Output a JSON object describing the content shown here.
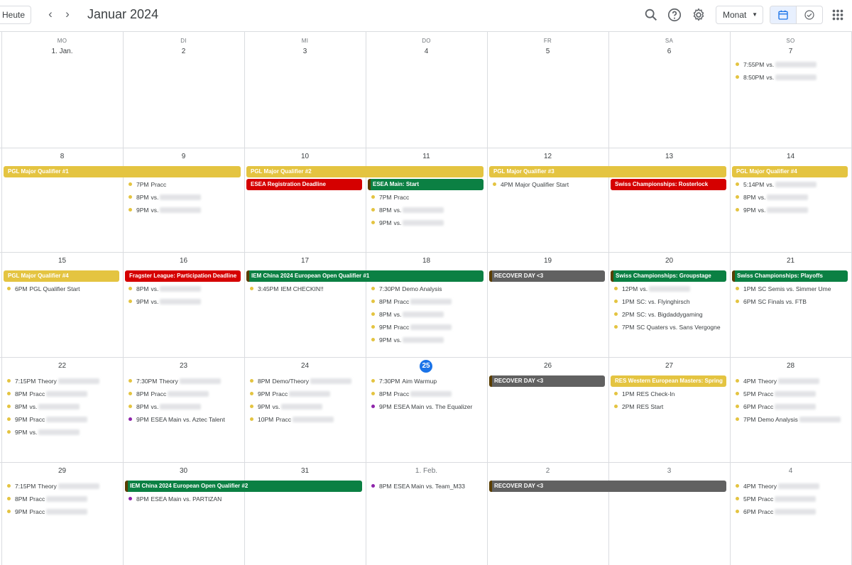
{
  "header": {
    "today_label": "Heute",
    "title": "Januar 2024",
    "view_label": "Monat",
    "icons": [
      "chevron-left-icon",
      "chevron-right-icon",
      "search-icon",
      "help-icon",
      "settings-icon",
      "calendar-icon",
      "tasks-icon",
      "apps-icon"
    ]
  },
  "weekdays": [
    "MO",
    "DI",
    "MI",
    "DO",
    "FR",
    "SA",
    "SO"
  ],
  "weeks": [
    [
      "1. Jan.",
      "2",
      "3",
      "4",
      "5",
      "6",
      "7"
    ],
    [
      "8",
      "9",
      "10",
      "11",
      "12",
      "13",
      "14"
    ],
    [
      "15",
      "16",
      "17",
      "18",
      "19",
      "20",
      "21"
    ],
    [
      "22",
      "23",
      "24",
      "25",
      "26",
      "27",
      "28"
    ],
    [
      "29",
      "30",
      "31",
      "1. Feb.",
      "2",
      "3",
      "4"
    ]
  ],
  "today": {
    "week": 3,
    "day": 3,
    "label": "25"
  },
  "colors": {
    "yellow": "#e4c441",
    "red": "#d50000",
    "green": "#0b8043",
    "gray": "#616161",
    "purple": "#8e24aa",
    "today": "#1a73e8"
  },
  "banners": [
    {
      "week": 1,
      "start": 0,
      "span": 2,
      "row": 0,
      "label": "PGL Major Qualifier #1",
      "color": "#e4c441"
    },
    {
      "week": 1,
      "start": 2,
      "span": 2,
      "row": 0,
      "label": "PGL Major Qualifier #2",
      "color": "#e4c441"
    },
    {
      "week": 1,
      "start": 4,
      "span": 2,
      "row": 0,
      "label": "PGL Major Qualifier #3",
      "color": "#e4c441"
    },
    {
      "week": 1,
      "start": 6,
      "span": 1,
      "row": 0,
      "label": "PGL Major Qualifier #4",
      "color": "#e4c441"
    },
    {
      "week": 1,
      "start": 2,
      "span": 1,
      "row": 1,
      "label": "ESEA Registration Deadline",
      "color": "#d50000"
    },
    {
      "week": 1,
      "start": 3,
      "span": 1,
      "row": 1,
      "label": "ESEA Main: Start",
      "color": "#0b8043"
    },
    {
      "week": 1,
      "start": 5,
      "span": 1,
      "row": 1,
      "label": "Swiss Championships: Rosterlock",
      "color": "#d50000"
    },
    {
      "week": 2,
      "start": 0,
      "span": 1,
      "row": 0,
      "label": "PGL Major Qualifier #4",
      "color": "#e4c441"
    },
    {
      "week": 2,
      "start": 1,
      "span": 1,
      "row": 0,
      "label": "Fragster League: Participation Deadline",
      "color": "#d50000"
    },
    {
      "week": 2,
      "start": 2,
      "span": 2,
      "row": 0,
      "label": "IEM China 2024 European Open Qualifier #1",
      "color": "#0b8043"
    },
    {
      "week": 2,
      "start": 4,
      "span": 1,
      "row": 0,
      "label": "RECOVER DAY <3",
      "color": "#616161"
    },
    {
      "week": 2,
      "start": 5,
      "span": 1,
      "row": 0,
      "label": "Swiss Championships: Groupstage",
      "color": "#0b8043"
    },
    {
      "week": 2,
      "start": 6,
      "span": 1,
      "row": 0,
      "label": "Swiss Championships: Playoffs",
      "color": "#0b8043"
    },
    {
      "week": 3,
      "start": 4,
      "span": 1,
      "row": 0,
      "label": "RECOVER DAY <3",
      "color": "#616161"
    },
    {
      "week": 3,
      "start": 5,
      "span": 1,
      "row": 0,
      "label": "RES Western European Masters: Spring",
      "color": "#e4c441"
    },
    {
      "week": 4,
      "start": 1,
      "span": 2,
      "row": 0,
      "label": "IEM China 2024 European Open Qualifier #2",
      "color": "#0b8043"
    },
    {
      "week": 4,
      "start": 4,
      "span": 2,
      "row": 0,
      "label": "RECOVER DAY <3",
      "color": "#616161"
    }
  ],
  "events": [
    {
      "week": 0,
      "day": 6,
      "row": 0,
      "time": "7:55PM",
      "title": "vs.",
      "blur": true,
      "color": "#e4c441"
    },
    {
      "week": 0,
      "day": 6,
      "row": 1,
      "time": "8:50PM",
      "title": "vs.",
      "blur": true,
      "color": "#e4c441"
    },
    {
      "week": 1,
      "day": 1,
      "row": 1,
      "time": "7PM",
      "title": "Pracc",
      "blur": false,
      "color": "#e4c441"
    },
    {
      "week": 1,
      "day": 1,
      "row": 2,
      "time": "8PM",
      "title": "vs.",
      "blur": true,
      "color": "#e4c441"
    },
    {
      "week": 1,
      "day": 1,
      "row": 3,
      "time": "9PM",
      "title": "vs.",
      "blur": true,
      "color": "#e4c441"
    },
    {
      "week": 1,
      "day": 3,
      "row": 2,
      "time": "7PM",
      "title": "Pracc",
      "blur": false,
      "color": "#e4c441"
    },
    {
      "week": 1,
      "day": 3,
      "row": 3,
      "time": "8PM",
      "title": "vs.",
      "blur": true,
      "color": "#e4c441"
    },
    {
      "week": 1,
      "day": 3,
      "row": 4,
      "time": "9PM",
      "title": "vs.",
      "blur": true,
      "color": "#e4c441"
    },
    {
      "week": 1,
      "day": 4,
      "row": 1,
      "time": "4PM",
      "title": "Major Qualifier Start",
      "blur": false,
      "color": "#e4c441"
    },
    {
      "week": 1,
      "day": 6,
      "row": 1,
      "time": "5:14PM",
      "title": "vs.",
      "blur": true,
      "color": "#e4c441"
    },
    {
      "week": 1,
      "day": 6,
      "row": 2,
      "time": "8PM",
      "title": "vs.",
      "blur": true,
      "color": "#e4c441"
    },
    {
      "week": 1,
      "day": 6,
      "row": 3,
      "time": "9PM",
      "title": "vs.",
      "blur": true,
      "color": "#e4c441"
    },
    {
      "week": 2,
      "day": 0,
      "row": 1,
      "time": "6PM",
      "title": "PGL Qualifier Start",
      "blur": false,
      "color": "#e4c441"
    },
    {
      "week": 2,
      "day": 1,
      "row": 1,
      "time": "8PM",
      "title": "vs.",
      "blur": true,
      "color": "#e4c441"
    },
    {
      "week": 2,
      "day": 1,
      "row": 2,
      "time": "9PM",
      "title": "vs.",
      "blur": true,
      "color": "#e4c441"
    },
    {
      "week": 2,
      "day": 2,
      "row": 1,
      "time": "3:45PM",
      "title": "IEM CHECKIN!!",
      "blur": false,
      "color": "#e4c441"
    },
    {
      "week": 2,
      "day": 3,
      "row": 1,
      "time": "7:30PM",
      "title": "Demo Analysis",
      "blur": false,
      "color": "#e4c441"
    },
    {
      "week": 2,
      "day": 3,
      "row": 2,
      "time": "8PM",
      "title": "Pracc",
      "blur": true,
      "color": "#e4c441"
    },
    {
      "week": 2,
      "day": 3,
      "row": 3,
      "time": "8PM",
      "title": "vs.",
      "blur": true,
      "color": "#e4c441"
    },
    {
      "week": 2,
      "day": 3,
      "row": 4,
      "time": "9PM",
      "title": "Pracc",
      "blur": true,
      "color": "#e4c441"
    },
    {
      "week": 2,
      "day": 3,
      "row": 5,
      "time": "9PM",
      "title": "vs.",
      "blur": true,
      "color": "#e4c441"
    },
    {
      "week": 2,
      "day": 5,
      "row": 1,
      "time": "12PM",
      "title": "vs.",
      "blur": true,
      "color": "#e4c441"
    },
    {
      "week": 2,
      "day": 5,
      "row": 2,
      "time": "1PM",
      "title": "SC: vs. Flyinghirsch",
      "blur": false,
      "color": "#e4c441"
    },
    {
      "week": 2,
      "day": 5,
      "row": 3,
      "time": "2PM",
      "title": "SC: vs. Bigdaddygaming",
      "blur": false,
      "color": "#e4c441"
    },
    {
      "week": 2,
      "day": 5,
      "row": 4,
      "time": "7PM",
      "title": "SC Quaters vs. Sans Vergogne",
      "blur": false,
      "color": "#e4c441"
    },
    {
      "week": 2,
      "day": 6,
      "row": 1,
      "time": "1PM",
      "title": "SC Semis vs. Simmer Ume",
      "blur": false,
      "color": "#e4c441"
    },
    {
      "week": 2,
      "day": 6,
      "row": 2,
      "time": "6PM",
      "title": "SC Finals vs. FTB",
      "blur": false,
      "color": "#e4c441"
    },
    {
      "week": 3,
      "day": 0,
      "row": 0,
      "time": "7:15PM",
      "title": "Theory",
      "blur": true,
      "color": "#e4c441"
    },
    {
      "week": 3,
      "day": 0,
      "row": 1,
      "time": "8PM",
      "title": "Pracc",
      "blur": true,
      "color": "#e4c441"
    },
    {
      "week": 3,
      "day": 0,
      "row": 2,
      "time": "8PM",
      "title": "vs.",
      "blur": true,
      "color": "#e4c441"
    },
    {
      "week": 3,
      "day": 0,
      "row": 3,
      "time": "9PM",
      "title": "Pracc",
      "blur": true,
      "color": "#e4c441"
    },
    {
      "week": 3,
      "day": 0,
      "row": 4,
      "time": "9PM",
      "title": "vs.",
      "blur": true,
      "color": "#e4c441"
    },
    {
      "week": 3,
      "day": 1,
      "row": 0,
      "time": "7:30PM",
      "title": "Theory",
      "blur": true,
      "color": "#e4c441"
    },
    {
      "week": 3,
      "day": 1,
      "row": 1,
      "time": "8PM",
      "title": "Pracc",
      "blur": true,
      "color": "#e4c441"
    },
    {
      "week": 3,
      "day": 1,
      "row": 2,
      "time": "8PM",
      "title": "vs.",
      "blur": true,
      "color": "#e4c441"
    },
    {
      "week": 3,
      "day": 1,
      "row": 3,
      "time": "9PM",
      "title": "ESEA Main vs. Aztec Talent",
      "blur": false,
      "color": "#8e24aa"
    },
    {
      "week": 3,
      "day": 2,
      "row": 0,
      "time": "8PM",
      "title": "Demo/Theory",
      "blur": true,
      "color": "#e4c441"
    },
    {
      "week": 3,
      "day": 2,
      "row": 1,
      "time": "9PM",
      "title": "Pracc",
      "blur": true,
      "color": "#e4c441"
    },
    {
      "week": 3,
      "day": 2,
      "row": 2,
      "time": "9PM",
      "title": "vs.",
      "blur": true,
      "color": "#e4c441"
    },
    {
      "week": 3,
      "day": 2,
      "row": 3,
      "time": "10PM",
      "title": "Pracc",
      "blur": true,
      "color": "#e4c441"
    },
    {
      "week": 3,
      "day": 3,
      "row": 0,
      "time": "7:30PM",
      "title": "Aim Warmup",
      "blur": false,
      "color": "#e4c441"
    },
    {
      "week": 3,
      "day": 3,
      "row": 1,
      "time": "8PM",
      "title": "Pracc",
      "blur": true,
      "color": "#e4c441"
    },
    {
      "week": 3,
      "day": 3,
      "row": 2,
      "time": "9PM",
      "title": "ESEA Main vs. The Equalizer",
      "blur": false,
      "color": "#8e24aa"
    },
    {
      "week": 3,
      "day": 5,
      "row": 1,
      "time": "1PM",
      "title": "RES Check-In",
      "blur": false,
      "color": "#e4c441"
    },
    {
      "week": 3,
      "day": 5,
      "row": 2,
      "time": "2PM",
      "title": "RES Start",
      "blur": false,
      "color": "#e4c441"
    },
    {
      "week": 3,
      "day": 6,
      "row": 0,
      "time": "4PM",
      "title": "Theory",
      "blur": true,
      "color": "#e4c441"
    },
    {
      "week": 3,
      "day": 6,
      "row": 1,
      "time": "5PM",
      "title": "Pracc",
      "blur": true,
      "color": "#e4c441"
    },
    {
      "week": 3,
      "day": 6,
      "row": 2,
      "time": "6PM",
      "title": "Pracc",
      "blur": true,
      "color": "#e4c441"
    },
    {
      "week": 3,
      "day": 6,
      "row": 3,
      "time": "7PM",
      "title": "Demo Analysis",
      "blur": true,
      "color": "#e4c441"
    },
    {
      "week": 4,
      "day": 0,
      "row": 0,
      "time": "7:15PM",
      "title": "Theory",
      "blur": true,
      "color": "#e4c441"
    },
    {
      "week": 4,
      "day": 0,
      "row": 1,
      "time": "8PM",
      "title": "Pracc",
      "blur": true,
      "color": "#e4c441"
    },
    {
      "week": 4,
      "day": 0,
      "row": 2,
      "time": "9PM",
      "title": "Pracc",
      "blur": true,
      "color": "#e4c441"
    },
    {
      "week": 4,
      "day": 1,
      "row": 1,
      "time": "8PM",
      "title": "ESEA Main vs. PARTIZAN",
      "blur": false,
      "color": "#8e24aa"
    },
    {
      "week": 4,
      "day": 3,
      "row": 0,
      "time": "8PM",
      "title": "ESEA Main vs. Team_M33",
      "blur": false,
      "color": "#8e24aa"
    },
    {
      "week": 4,
      "day": 6,
      "row": 0,
      "time": "4PM",
      "title": "Theory",
      "blur": true,
      "color": "#e4c441"
    },
    {
      "week": 4,
      "day": 6,
      "row": 1,
      "time": "5PM",
      "title": "Pracc",
      "blur": true,
      "color": "#e4c441"
    },
    {
      "week": 4,
      "day": 6,
      "row": 2,
      "time": "6PM",
      "title": "Pracc",
      "blur": true,
      "color": "#e4c441"
    }
  ]
}
